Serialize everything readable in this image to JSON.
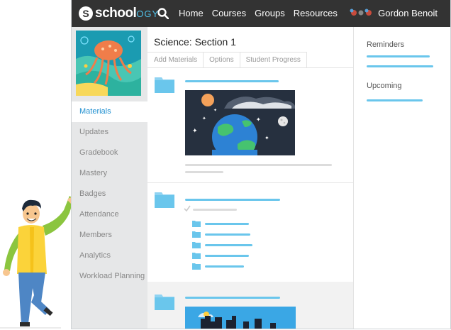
{
  "logo": {
    "badge": "S",
    "text": "school",
    "accent": "OGY"
  },
  "nav": {
    "items": [
      "Home",
      "Courses",
      "Groups",
      "Resources"
    ]
  },
  "user": {
    "name": "Gordon Benoit"
  },
  "course": {
    "title": "Science: Section 1"
  },
  "tabs": [
    "Add Materials",
    "Options",
    "Student Progress"
  ],
  "sidebar": {
    "items": [
      "Materials",
      "Updates",
      "Gradebook",
      "Mastery",
      "Badges",
      "Attendance",
      "Members",
      "Analytics",
      "Workload Planning"
    ],
    "active": "Materials"
  },
  "right": {
    "reminders": "Reminders",
    "upcoming": "Upcoming"
  },
  "colors": {
    "topbar": "#333333",
    "accent": "#6ac6ec",
    "link": "#1e8fd0"
  },
  "icons": [
    "search-icon",
    "folder-icon",
    "check-icon"
  ]
}
